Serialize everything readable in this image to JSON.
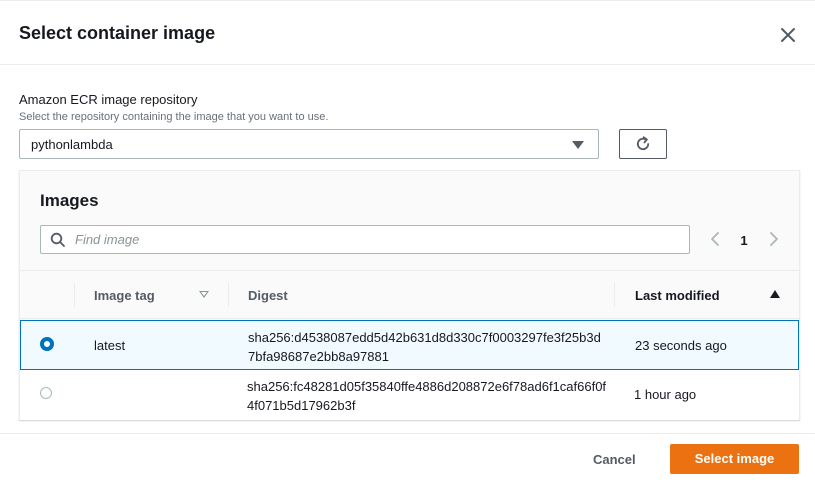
{
  "modal": {
    "title": "Select container image"
  },
  "repository": {
    "label": "Amazon ECR image repository",
    "description": "Select the repository containing the image that you want to use.",
    "selected_value": "pythonlambda"
  },
  "images": {
    "title": "Images",
    "search_placeholder": "Find image",
    "search_value": "",
    "current_page": "1",
    "columns": {
      "image_tag": "Image tag",
      "digest": "Digest",
      "last_modified": "Last modified"
    },
    "rows": [
      {
        "selected": true,
        "image_tag": "latest",
        "digest": "sha256:d4538087edd5d42b631d8d330c7f0003297fe3f25b3d7bfa98687e2bb8a97881",
        "last_modified": "23 seconds ago"
      },
      {
        "selected": false,
        "image_tag": "",
        "digest": "sha256:fc48281d05f35840ffe4886d208872e6f78ad6f1caf66f0f4f071b5d17962b3f",
        "last_modified": "1 hour ago"
      }
    ]
  },
  "footer": {
    "cancel_label": "Cancel",
    "primary_label": "Select image"
  },
  "colors": {
    "primary_button": "#ec7211",
    "selection_border": "#0073bb",
    "selection_background": "#f1faff"
  },
  "icons": {
    "close": "close-icon",
    "dropdown": "caret-down-icon",
    "refresh": "refresh-icon",
    "search": "search-icon",
    "pager_previous": "chevron-left-icon",
    "pager_next": "chevron-right-icon"
  }
}
